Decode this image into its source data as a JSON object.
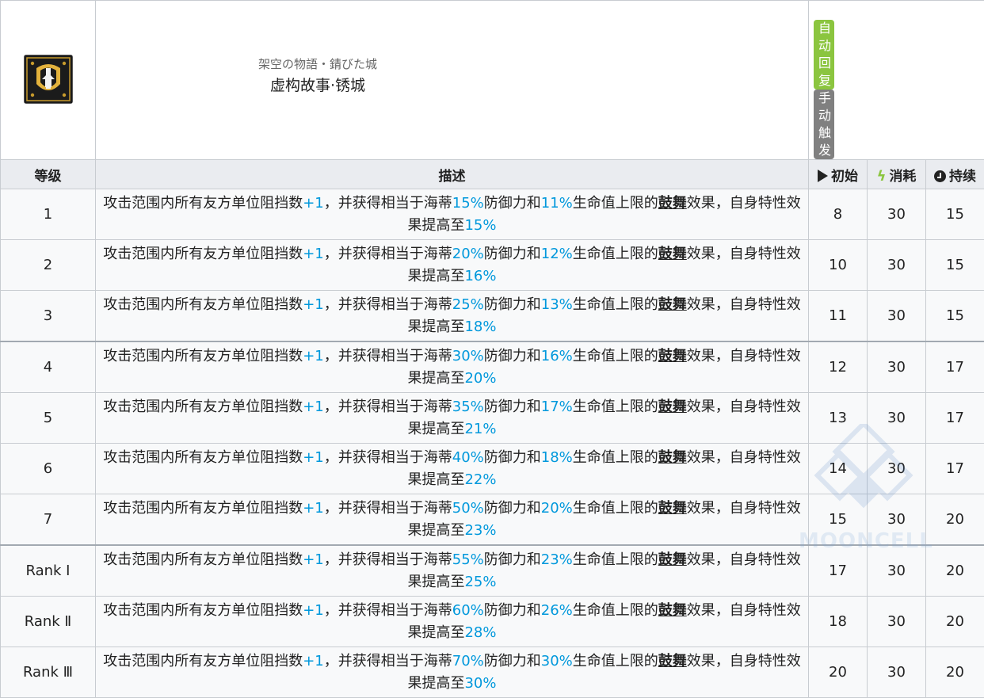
{
  "skill": {
    "name_jp": "架空の物語・錆びた城",
    "name_cn": "虚构故事·锈城",
    "tag_sp": "自动回复",
    "tag_trigger": "手动触发",
    "icon": "skill-emblem-icon"
  },
  "columns": {
    "level": "等级",
    "description": "描述",
    "initial": "初始",
    "cost": "消耗",
    "duration": "持续"
  },
  "levels": [
    {
      "level": "1",
      "d_a": "攻击范围内所有友方单位阻挡数",
      "d_b": "+1",
      "d_c": "，并获得相当于海蒂",
      "d_d": "15%",
      "d_e": "防御力和",
      "d_f": "11%",
      "d_g": "生命值上限的",
      "d_h": "鼓舞",
      "d_i": "效果，自身特性效果提高至",
      "d_j": "15%",
      "initial": "8",
      "cost": "30",
      "duration": "15"
    },
    {
      "level": "2",
      "d_a": "攻击范围内所有友方单位阻挡数",
      "d_b": "+1",
      "d_c": "，并获得相当于海蒂",
      "d_d": "20%",
      "d_e": "防御力和",
      "d_f": "12%",
      "d_g": "生命值上限的",
      "d_h": "鼓舞",
      "d_i": "效果，自身特性效果提高至",
      "d_j": "16%",
      "initial": "10",
      "cost": "30",
      "duration": "15"
    },
    {
      "level": "3",
      "d_a": "攻击范围内所有友方单位阻挡数",
      "d_b": "+1",
      "d_c": "，并获得相当于海蒂",
      "d_d": "25%",
      "d_e": "防御力和",
      "d_f": "13%",
      "d_g": "生命值上限的",
      "d_h": "鼓舞",
      "d_i": "效果，自身特性效果提高至",
      "d_j": "18%",
      "initial": "11",
      "cost": "30",
      "duration": "15"
    },
    {
      "level": "4",
      "d_a": "攻击范围内所有友方单位阻挡数",
      "d_b": "+1",
      "d_c": "，并获得相当于海蒂",
      "d_d": "30%",
      "d_e": "防御力和",
      "d_f": "16%",
      "d_g": "生命值上限的",
      "d_h": "鼓舞",
      "d_i": "效果，自身特性效果提高至",
      "d_j": "20%",
      "initial": "12",
      "cost": "30",
      "duration": "17"
    },
    {
      "level": "5",
      "d_a": "攻击范围内所有友方单位阻挡数",
      "d_b": "+1",
      "d_c": "，并获得相当于海蒂",
      "d_d": "35%",
      "d_e": "防御力和",
      "d_f": "17%",
      "d_g": "生命值上限的",
      "d_h": "鼓舞",
      "d_i": "效果，自身特性效果提高至",
      "d_j": "21%",
      "initial": "13",
      "cost": "30",
      "duration": "17"
    },
    {
      "level": "6",
      "d_a": "攻击范围内所有友方单位阻挡数",
      "d_b": "+1",
      "d_c": "，并获得相当于海蒂",
      "d_d": "40%",
      "d_e": "防御力和",
      "d_f": "18%",
      "d_g": "生命值上限的",
      "d_h": "鼓舞",
      "d_i": "效果，自身特性效果提高至",
      "d_j": "22%",
      "initial": "14",
      "cost": "30",
      "duration": "17"
    },
    {
      "level": "7",
      "d_a": "攻击范围内所有友方单位阻挡数",
      "d_b": "+1",
      "d_c": "，并获得相当于海蒂",
      "d_d": "50%",
      "d_e": "防御力和",
      "d_f": "20%",
      "d_g": "生命值上限的",
      "d_h": "鼓舞",
      "d_i": "效果，自身特性效果提高至",
      "d_j": "23%",
      "initial": "15",
      "cost": "30",
      "duration": "20"
    },
    {
      "level": "Rank Ⅰ",
      "d_a": "攻击范围内所有友方单位阻挡数",
      "d_b": "+1",
      "d_c": "，并获得相当于海蒂",
      "d_d": "55%",
      "d_e": "防御力和",
      "d_f": "23%",
      "d_g": "生命值上限的",
      "d_h": "鼓舞",
      "d_i": "效果，自身特性效果提高至",
      "d_j": "25%",
      "initial": "17",
      "cost": "30",
      "duration": "20"
    },
    {
      "level": "Rank Ⅱ",
      "d_a": "攻击范围内所有友方单位阻挡数",
      "d_b": "+1",
      "d_c": "，并获得相当于海蒂",
      "d_d": "60%",
      "d_e": "防御力和",
      "d_f": "26%",
      "d_g": "生命值上限的",
      "d_h": "鼓舞",
      "d_i": "效果，自身特性效果提高至",
      "d_j": "28%",
      "initial": "18",
      "cost": "30",
      "duration": "20"
    },
    {
      "level": "Rank Ⅲ",
      "d_a": "攻击范围内所有友方单位阻挡数",
      "d_b": "+1",
      "d_c": "，并获得相当于海蒂",
      "d_d": "70%",
      "d_e": "防御力和",
      "d_f": "30%",
      "d_g": "生命值上限的",
      "d_h": "鼓舞",
      "d_i": "效果，自身特性效果提高至",
      "d_j": "30%",
      "initial": "20",
      "cost": "30",
      "duration": "20"
    }
  ],
  "watermark": "MOONCELL",
  "colors": {
    "highlight": "#0098dc",
    "sp_tag": "#8bc53f",
    "trigger_tag": "#808080",
    "header_bg": "#eaecf0",
    "row_bg": "#f8f9fa"
  }
}
